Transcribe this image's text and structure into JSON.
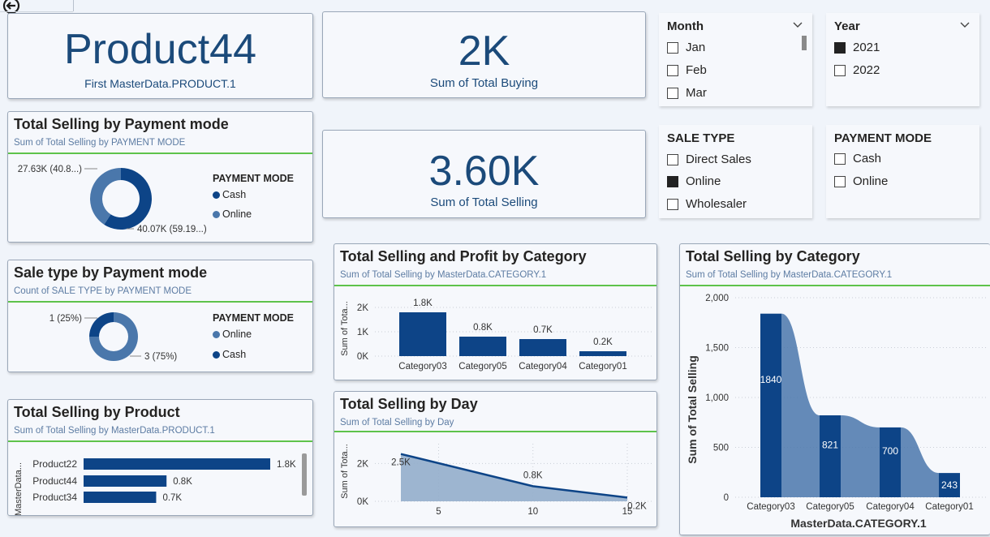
{
  "nav": {
    "back_icon": "back-arrow-icon"
  },
  "kpi_product": {
    "value": "Product44",
    "caption": "First MasterData.PRODUCT.1"
  },
  "kpi_buying": {
    "value": "2K",
    "caption": "Sum of Total Buying"
  },
  "kpi_selling": {
    "value": "3.60K",
    "caption": "Sum of Total Selling"
  },
  "slicer_month": {
    "title": "Month",
    "items": [
      {
        "label": "Jan",
        "checked": false
      },
      {
        "label": "Feb",
        "checked": false
      },
      {
        "label": "Mar",
        "checked": false
      }
    ]
  },
  "slicer_year": {
    "title": "Year",
    "items": [
      {
        "label": "2021",
        "checked": true
      },
      {
        "label": "2022",
        "checked": false
      }
    ]
  },
  "slicer_sale_type": {
    "title": "SALE TYPE",
    "items": [
      {
        "label": "Direct Sales",
        "checked": false
      },
      {
        "label": "Online",
        "checked": true
      },
      {
        "label": "Wholesaler",
        "checked": false
      }
    ]
  },
  "slicer_payment_mode": {
    "title": "PAYMENT MODE",
    "items": [
      {
        "label": "Cash",
        "checked": false
      },
      {
        "label": "Online",
        "checked": false
      }
    ]
  },
  "colors": {
    "dark_blue": "#0d4487",
    "mid_blue": "#4a77ab",
    "area_fill": "#94adcb",
    "green_rule": "#5ec34b",
    "kpi_text": "#1b4a7a"
  },
  "visual_payment": {
    "title": "Total Selling by Payment mode",
    "subtitle": "Sum of Total Selling by PAYMENT MODE",
    "legend_title": "PAYMENT MODE",
    "legend": [
      "Cash",
      "Online"
    ],
    "label_a": "27.63K (40.8...)",
    "label_b": "40.07K (59.19...)"
  },
  "visual_saletype": {
    "title": "Sale type by Payment mode",
    "subtitle": "Count of SALE TYPE by PAYMENT MODE",
    "legend_title": "PAYMENT MODE",
    "legend": [
      "Online",
      "Cash"
    ],
    "label_a": "1 (25%)",
    "label_b": "3 (75%)"
  },
  "visual_product": {
    "title": "Total Selling by Product",
    "subtitle": "Sum of Total Selling by MasterData.PRODUCT.1",
    "y_axis": "MasterData..."
  },
  "visual_cat_profit": {
    "title": "Total Selling and Profit by Category",
    "subtitle": "Sum of Total Selling by MasterData.CATEGORY.1",
    "y_axis": "Sum of Tota..."
  },
  "visual_day": {
    "title": "Total Selling by Day",
    "subtitle": "Sum of Total Selling by Day",
    "y_axis": "Sum of Tota..."
  },
  "visual_category": {
    "title": "Total Selling by Category",
    "subtitle": "Sum of Total Selling by MasterData.CATEGORY.1",
    "y_axis": "Sum of Total Selling",
    "x_axis": "MasterData.CATEGORY.1"
  },
  "chart_data": [
    {
      "id": "payment_donut",
      "type": "pie",
      "title": "Total Selling by Payment mode",
      "subtitle": "Sum of Total Selling by PAYMENT MODE",
      "legend_title": "PAYMENT MODE",
      "legend_position": "right",
      "series": [
        {
          "name": "Cash",
          "value": 40.07,
          "label": "40.07K (59.19...)",
          "color": "#0d4487"
        },
        {
          "name": "Online",
          "value": 27.63,
          "label": "27.63K (40.8...)",
          "color": "#4a77ab"
        }
      ]
    },
    {
      "id": "saletype_donut",
      "type": "pie",
      "title": "Sale type by Payment mode",
      "subtitle": "Count of SALE TYPE by PAYMENT MODE",
      "legend_title": "PAYMENT MODE",
      "legend_position": "right",
      "series": [
        {
          "name": "Online",
          "value": 3,
          "label": "3 (75%)",
          "color": "#4a77ab"
        },
        {
          "name": "Cash",
          "value": 1,
          "label": "1 (25%)",
          "color": "#0d4487"
        }
      ]
    },
    {
      "id": "product_bar",
      "type": "bar",
      "orientation": "horizontal",
      "title": "Total Selling by Product",
      "ylabel": "MasterData...",
      "categories": [
        "Product22",
        "Product44",
        "Product34"
      ],
      "values": [
        1.8,
        0.8,
        0.7
      ],
      "value_labels": [
        "1.8K",
        "0.8K",
        "0.7K"
      ],
      "xlim": [
        0,
        1.8
      ]
    },
    {
      "id": "category_profit_bar",
      "type": "bar",
      "title": "Total Selling and Profit by Category",
      "ylabel": "Sum of Tota...",
      "categories": [
        "Category03",
        "Category05",
        "Category04",
        "Category01"
      ],
      "values": [
        1.8,
        0.8,
        0.7,
        0.2
      ],
      "value_labels": [
        "1.8K",
        "0.8K",
        "0.7K",
        "0.2K"
      ],
      "yticks": [
        "0K",
        "1K",
        "2K"
      ],
      "ylim": [
        0,
        2
      ],
      "grid": true
    },
    {
      "id": "day_area",
      "type": "area",
      "title": "Total Selling by Day",
      "ylabel": "Sum of Tota...",
      "x": [
        3,
        10,
        15
      ],
      "values": [
        2.5,
        0.8,
        0.2
      ],
      "value_labels": [
        "2.5K",
        "0.8K",
        "0.2K"
      ],
      "xticks": [
        "5",
        "10",
        "15"
      ],
      "yticks": [
        "0K",
        "2K"
      ],
      "xlim": [
        3,
        15
      ],
      "ylim": [
        0,
        3
      ],
      "grid": true
    },
    {
      "id": "category_ribbon",
      "type": "bar",
      "title": "Total Selling by Category",
      "xlabel": "MasterData.CATEGORY.1",
      "ylabel": "Sum of Total Selling",
      "categories": [
        "Category03",
        "Category05",
        "Category04",
        "Category01"
      ],
      "values": [
        1840,
        821,
        700,
        243
      ],
      "value_labels": [
        "1840",
        "821",
        "700",
        "243"
      ],
      "yticks": [
        "0",
        "500",
        "1,000",
        "1,500",
        "2,000"
      ],
      "ylim": [
        0,
        2000
      ],
      "grid": true
    }
  ]
}
